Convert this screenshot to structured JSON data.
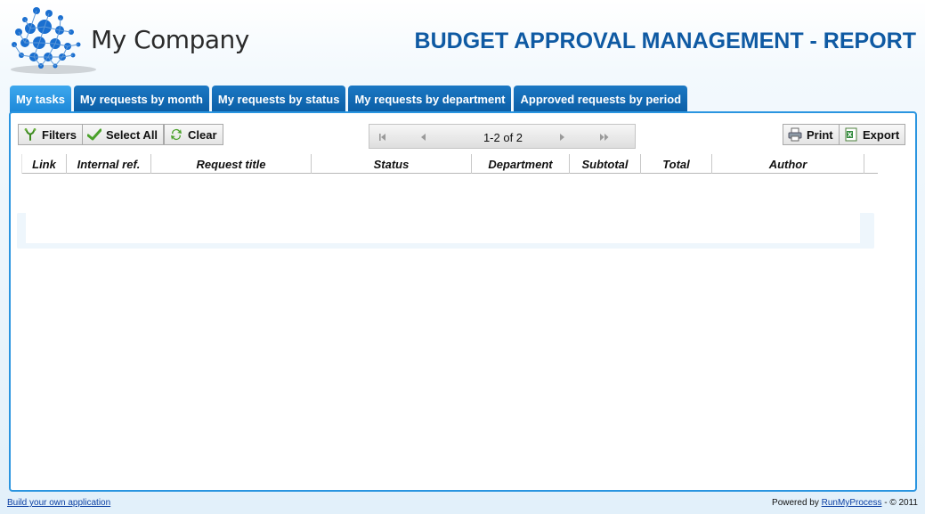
{
  "header": {
    "logo_text": "My Company",
    "app_title": "BUDGET APPROVAL MANAGEMENT - REPORT"
  },
  "tabs": [
    {
      "label": "My tasks",
      "active": true
    },
    {
      "label": "My requests by month",
      "active": false
    },
    {
      "label": "My requests by status",
      "active": false
    },
    {
      "label": "My requests by department",
      "active": false
    },
    {
      "label": "Approved requests by period",
      "active": false
    }
  ],
  "toolbar": {
    "filters_label": "Filters",
    "select_all_label": "Select All",
    "clear_label": "Clear",
    "print_label": "Print",
    "export_label": "Export"
  },
  "pager": {
    "range_text": "1-2 of 2"
  },
  "grid": {
    "columns": [
      "Link",
      "Internal ref.",
      "Request title",
      "Status",
      "Department",
      "Subtotal",
      "Total",
      "Author"
    ]
  },
  "footer": {
    "build_link": "Build your own application",
    "powered_by_prefix": "Powered by",
    "powered_by_link": "RunMyProcess",
    "copyright": "- © 2011"
  },
  "colors": {
    "accent": "#0f5aa3",
    "tab": "#0b5ea6",
    "tab_active": "#2a95e0",
    "panel_border": "#2a95e0"
  },
  "icons": [
    "company-logo",
    "filter-icon",
    "checkmark-icon",
    "refresh-icon",
    "first-page-icon",
    "prev-page-icon",
    "next-page-icon",
    "last-page-icon",
    "printer-icon",
    "excel-icon"
  ]
}
